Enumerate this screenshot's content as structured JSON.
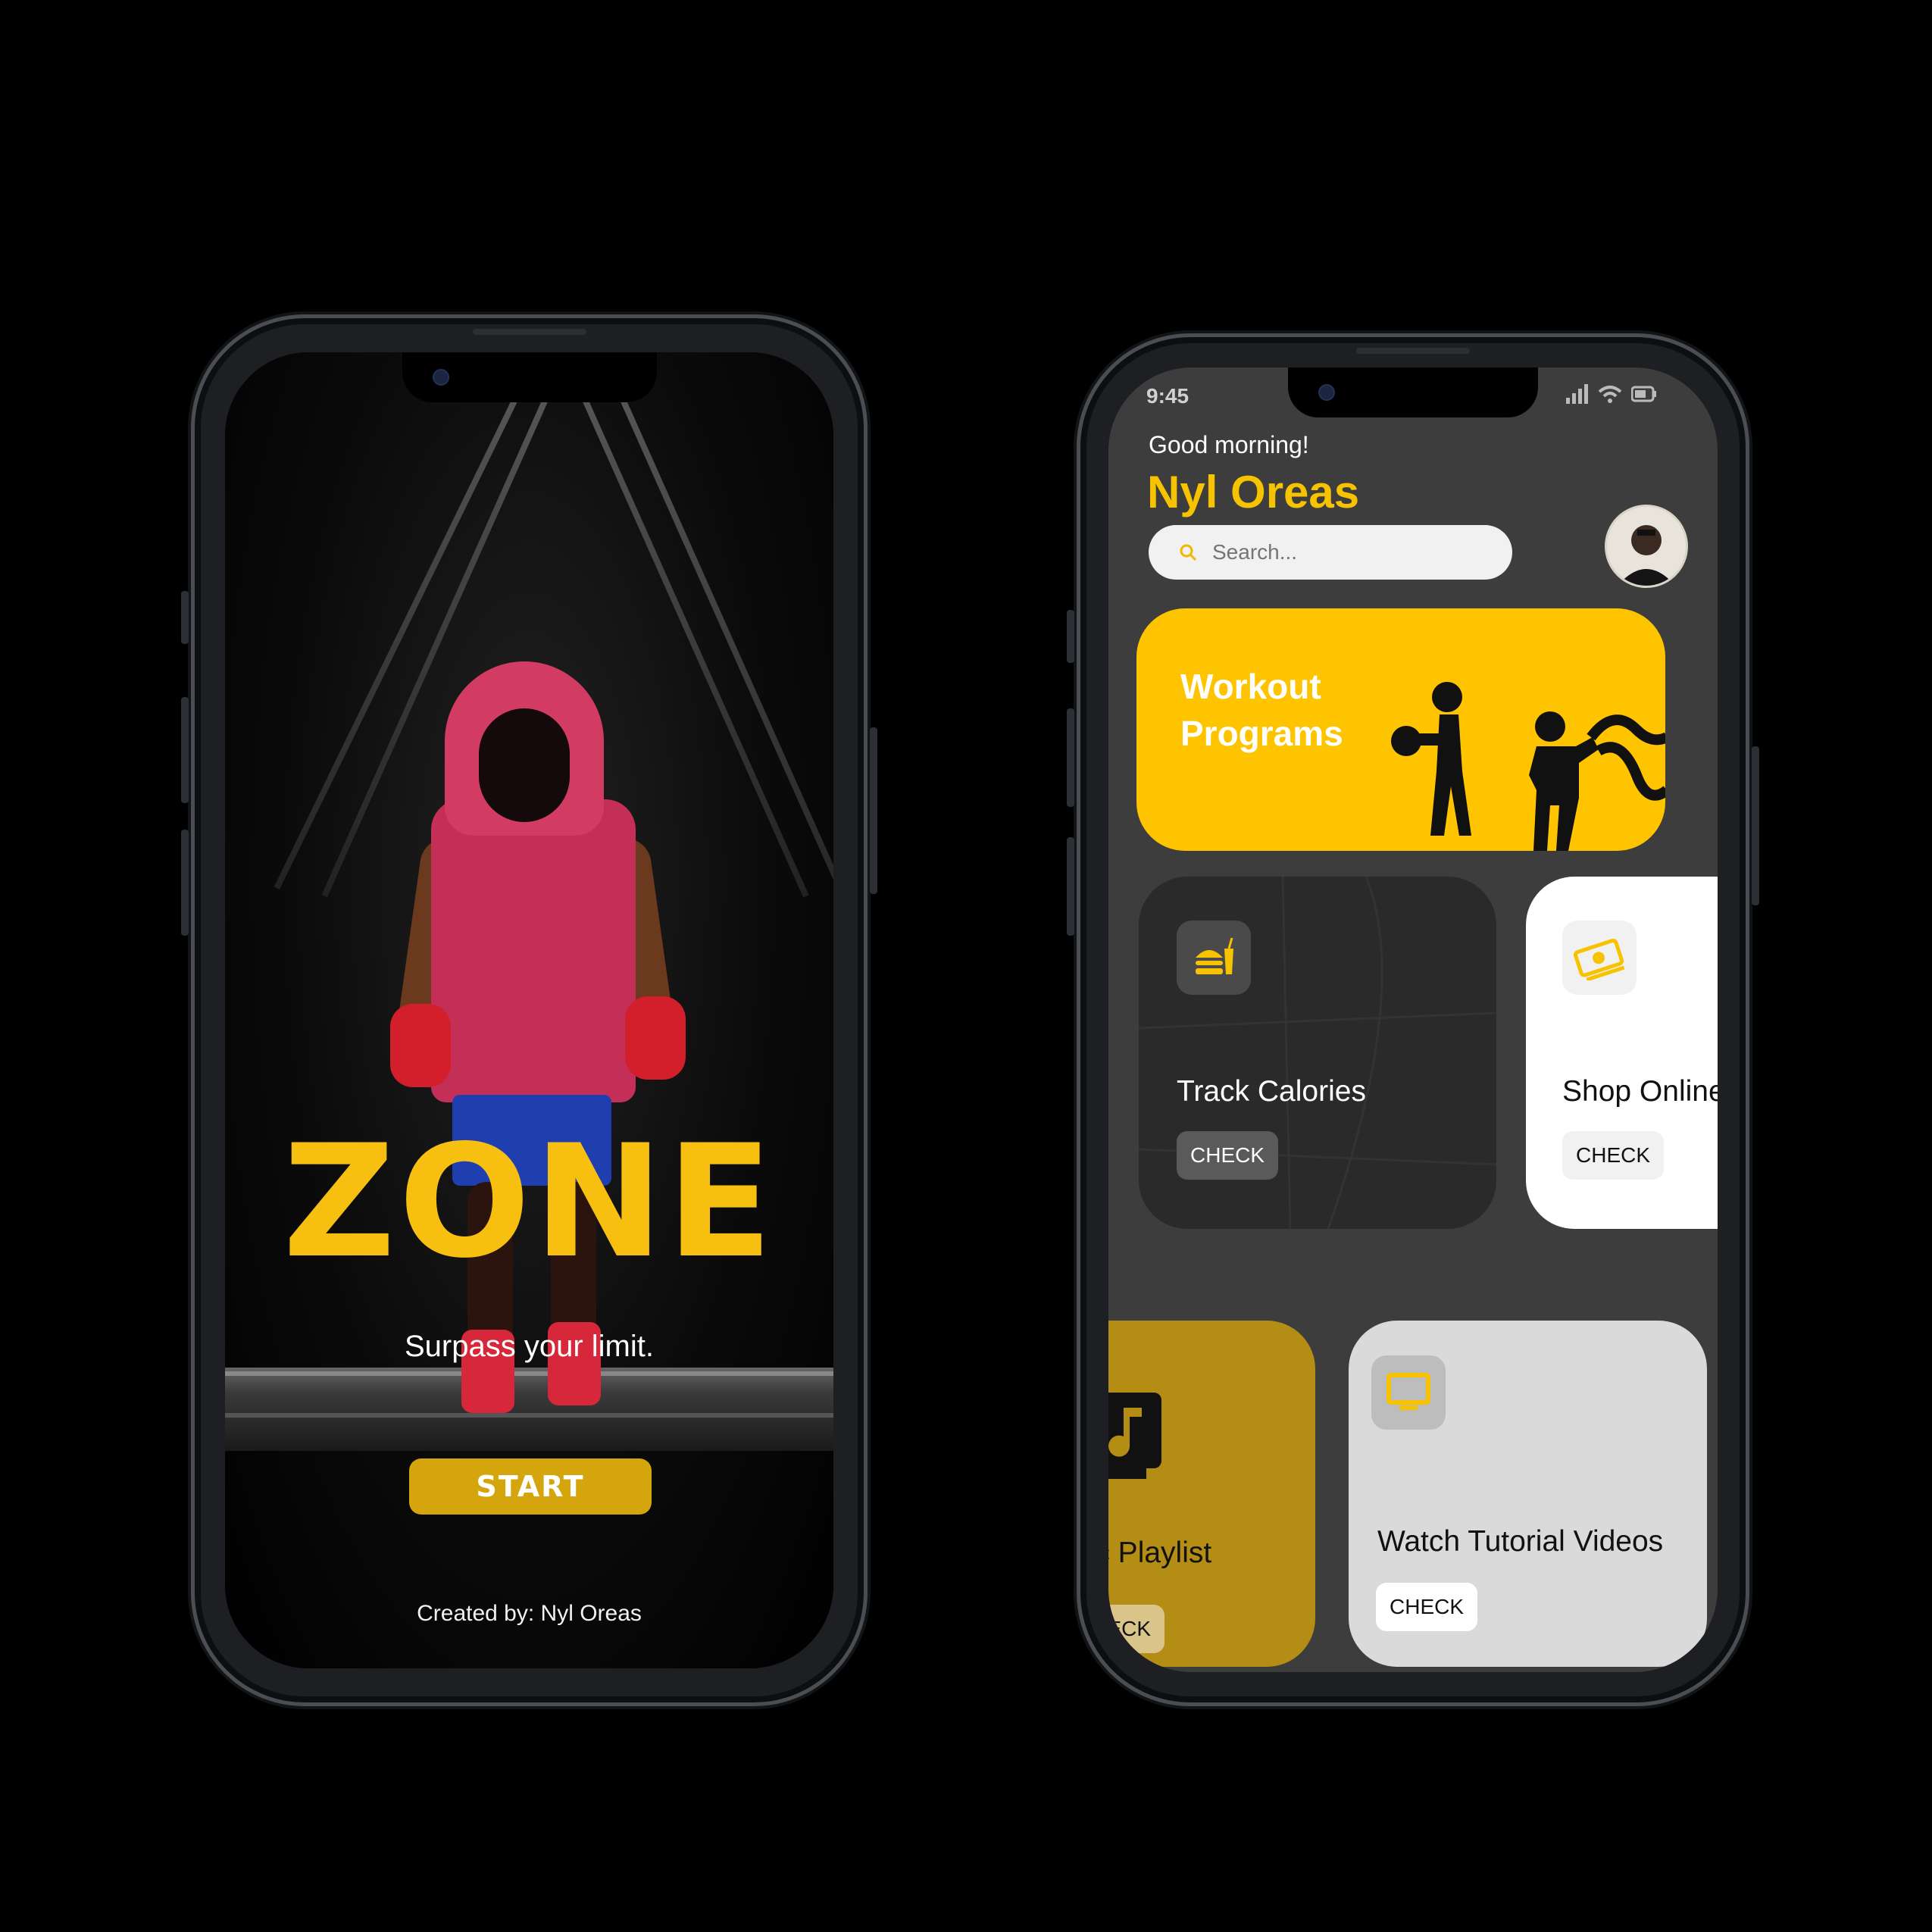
{
  "left_phone": {
    "title": "ZONE",
    "tagline": "Surpass your limit.",
    "start_label": "START",
    "credit": "Created by: Nyl Oreas"
  },
  "right_phone": {
    "status": {
      "time": "9:45"
    },
    "greeting": "Good morning!",
    "username": "Nyl Oreas",
    "search": {
      "placeholder": "Search..."
    },
    "cards": {
      "workout": {
        "line1": "Workout",
        "line2": "Programs"
      },
      "calories": {
        "label": "Track Calories",
        "button": "CHECK",
        "icon": "food-icon"
      },
      "shop": {
        "label": "Shop Online",
        "button": "CHECK",
        "icon": "money-icon"
      },
      "playlist": {
        "label": "Music Playlist",
        "button": "CHECK",
        "icon": "music-icon"
      },
      "tutorial": {
        "label": "Watch Tutorial Videos",
        "button": "CHECK",
        "icon": "tv-icon"
      }
    }
  },
  "colors": {
    "accent": "#ffc400",
    "start_button": "#d4a50c",
    "playlist_card": "#b48e14",
    "app_background": "#3d3d3d"
  }
}
